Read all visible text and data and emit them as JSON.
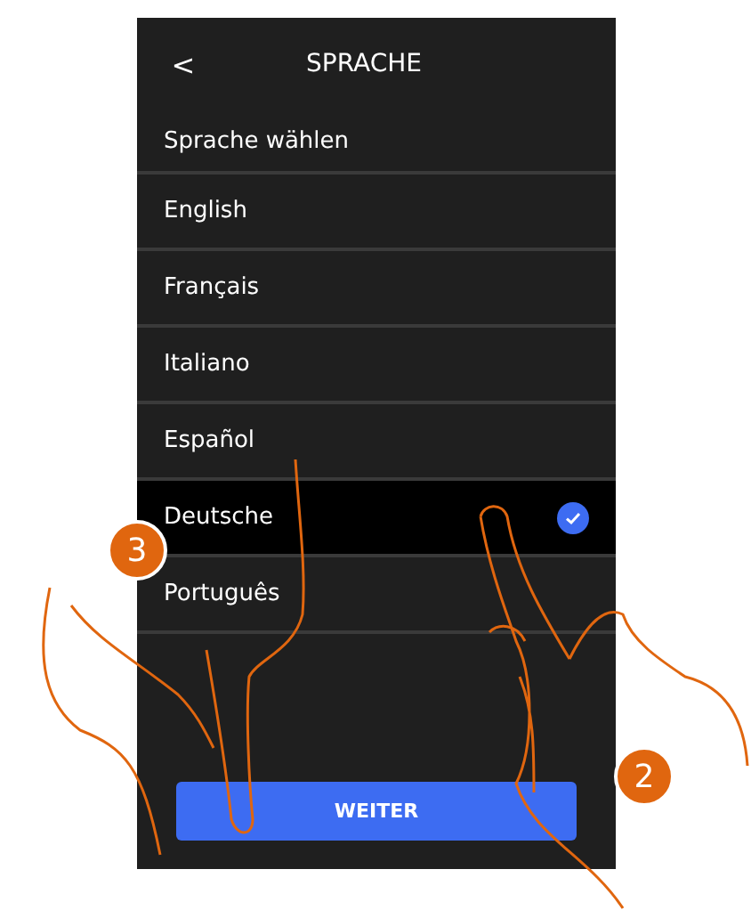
{
  "header": {
    "back": "<",
    "title": "SPRACHE"
  },
  "prompt": "Sprache wählen",
  "languages": [
    {
      "label": "English",
      "selected": false
    },
    {
      "label": "Français",
      "selected": false
    },
    {
      "label": "Italiano",
      "selected": false
    },
    {
      "label": "Español",
      "selected": false
    },
    {
      "label": "Deutsche",
      "selected": true
    },
    {
      "label": "Português",
      "selected": false
    }
  ],
  "button": "WEITER",
  "steps": [
    {
      "label": "3"
    },
    {
      "label": "2"
    }
  ]
}
